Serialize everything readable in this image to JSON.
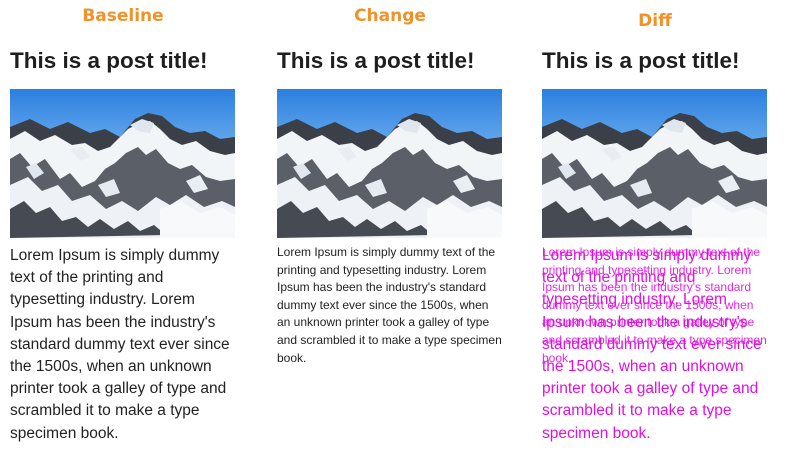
{
  "columns": {
    "baseline": {
      "label": "Baseline"
    },
    "change": {
      "label": "Change"
    },
    "diff": {
      "label": "Diff"
    }
  },
  "post": {
    "title": "This is a post title!",
    "body": "Lorem Ipsum is simply dummy text of the printing and typesetting industry. Lorem Ipsum has been the industry's standard dummy text ever since the 1500s, when an unknown printer took a galley of type and scrambled it to make a type specimen book.",
    "image": "snowy-mountain-photo"
  },
  "colors": {
    "label": "#f0922a",
    "title": "#1e1e1e",
    "text": "#222222",
    "diff_highlight": "#e010e0"
  }
}
